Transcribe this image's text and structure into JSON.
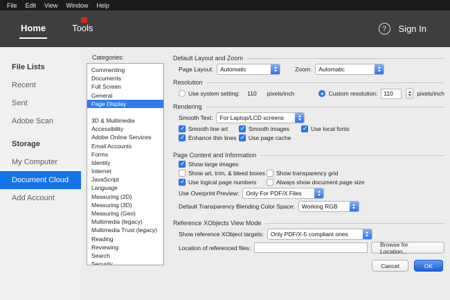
{
  "menubar": {
    "items": [
      {
        "label": "File"
      },
      {
        "label": "Edit"
      },
      {
        "label": "View"
      },
      {
        "label": "Window"
      },
      {
        "label": "Help"
      }
    ]
  },
  "toolbar": {
    "tabs": [
      {
        "label": "Home",
        "active": true
      },
      {
        "label": "Tools",
        "active": false
      }
    ],
    "help": "?",
    "sign_in_label": "Sign In"
  },
  "sidebar": {
    "sections": [
      {
        "header": "File Lists",
        "items": [
          {
            "label": "Recent"
          },
          {
            "label": "Sent"
          },
          {
            "label": "Adobe Scan"
          }
        ]
      },
      {
        "header": "Storage",
        "items": [
          {
            "label": "My Computer"
          },
          {
            "label": "Document Cloud",
            "selected": true
          },
          {
            "label": "Add Account"
          }
        ]
      }
    ]
  },
  "prefs": {
    "categories_label": "Categories:",
    "categories_top": [
      {
        "label": "Commenting"
      },
      {
        "label": "Documents"
      },
      {
        "label": "Full Screen"
      },
      {
        "label": "General"
      },
      {
        "label": "Page Display",
        "selected": true
      }
    ],
    "categories_rest": [
      {
        "label": "3D & Multimedia"
      },
      {
        "label": "Accessibility"
      },
      {
        "label": "Adobe Online Services"
      },
      {
        "label": "Email Accounts"
      },
      {
        "label": "Forms"
      },
      {
        "label": "Identity"
      },
      {
        "label": "Internet"
      },
      {
        "label": "JavaScript"
      },
      {
        "label": "Language"
      },
      {
        "label": "Measuring (2D)"
      },
      {
        "label": "Measuring (3D)"
      },
      {
        "label": "Measuring (Geo)"
      },
      {
        "label": "Multimedia (legacy)"
      },
      {
        "label": "Multimedia Trust (legacy)"
      },
      {
        "label": "Reading"
      },
      {
        "label": "Reviewing"
      },
      {
        "label": "Search"
      },
      {
        "label": "Security"
      }
    ],
    "layout_zoom": {
      "header": "Default Layout and Zoom",
      "page_layout_label": "Page Layout:",
      "page_layout_value": "Automatic",
      "zoom_label": "Zoom:",
      "zoom_value": "Automatic"
    },
    "resolution": {
      "header": "Resolution",
      "system_label": "Use system setting:",
      "system_value": "110",
      "system_unit": "pixels/inch",
      "system_selected": false,
      "custom_label": "Custom resolution:",
      "custom_value": "110",
      "custom_unit": "pixels/inch",
      "custom_selected": true
    },
    "rendering": {
      "header": "Rendering",
      "smooth_text_label": "Smooth Text:",
      "smooth_text_value": "For Laptop/LCD screens",
      "cb_smooth_line_art": {
        "label": "Smooth line art",
        "checked": true
      },
      "cb_smooth_images": {
        "label": "Smooth images",
        "checked": true
      },
      "cb_use_local_fonts": {
        "label": "Use local fonts",
        "checked": true
      },
      "cb_enhance_thin_lines": {
        "label": "Enhance thin lines",
        "checked": true
      },
      "cb_use_page_cache": {
        "label": "Use page cache",
        "checked": true
      }
    },
    "page_content": {
      "header": "Page Content and Information",
      "cb_show_large_images": {
        "label": "Show large images",
        "checked": true
      },
      "cb_show_art": {
        "label": "Show art, trim, & bleed boxes",
        "checked": false
      },
      "cb_show_transparency_grid": {
        "label": "Show transparency grid",
        "checked": false
      },
      "cb_logical_page_numbers": {
        "label": "Use logical page numbers",
        "checked": true
      },
      "cb_always_show_size": {
        "label": "Always show document page size",
        "checked": false
      },
      "overprint_label": "Use Overprint Preview:",
      "overprint_value": "Only For PDF/X Files",
      "blend_label": "Default Transparency Blending Color Space:",
      "blend_value": "Working RGB"
    },
    "xobjects": {
      "header": "Reference XObjects View Mode",
      "targets_label": "Show reference XObject targets:",
      "targets_value": "Only PDF/X-5 compliant ones",
      "location_label": "Location of referenced files:",
      "location_value": "",
      "browse_label": "Browse for Location..."
    },
    "buttons": {
      "cancel": "Cancel",
      "ok": "OK"
    }
  }
}
